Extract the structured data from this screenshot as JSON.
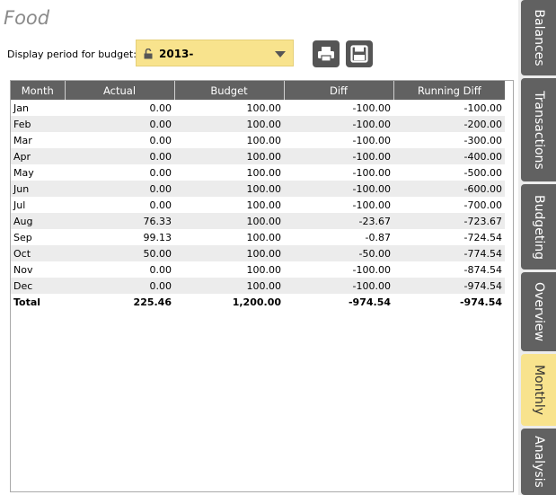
{
  "title": "Food",
  "period": {
    "label": "Display period for budget:",
    "value": "2013-"
  },
  "toolbar": {
    "print_icon": "printer-icon",
    "save_icon": "floppy-disk-icon"
  },
  "table": {
    "headers": [
      "Month",
      "Actual",
      "Budget",
      "Diff",
      "Running Diff"
    ],
    "rows": [
      [
        "Jan",
        "0.00",
        "100.00",
        "-100.00",
        "-100.00"
      ],
      [
        "Feb",
        "0.00",
        "100.00",
        "-100.00",
        "-200.00"
      ],
      [
        "Mar",
        "0.00",
        "100.00",
        "-100.00",
        "-300.00"
      ],
      [
        "Apr",
        "0.00",
        "100.00",
        "-100.00",
        "-400.00"
      ],
      [
        "May",
        "0.00",
        "100.00",
        "-100.00",
        "-500.00"
      ],
      [
        "Jun",
        "0.00",
        "100.00",
        "-100.00",
        "-600.00"
      ],
      [
        "Jul",
        "0.00",
        "100.00",
        "-100.00",
        "-700.00"
      ],
      [
        "Aug",
        "76.33",
        "100.00",
        "-23.67",
        "-723.67"
      ],
      [
        "Sep",
        "99.13",
        "100.00",
        "-0.87",
        "-724.54"
      ],
      [
        "Oct",
        "50.00",
        "100.00",
        "-50.00",
        "-774.54"
      ],
      [
        "Nov",
        "0.00",
        "100.00",
        "-100.00",
        "-874.54"
      ],
      [
        "Dec",
        "0.00",
        "100.00",
        "-100.00",
        "-974.54"
      ]
    ],
    "total": [
      "Total",
      "225.46",
      "1,200.00",
      "-974.54",
      "-974.54"
    ]
  },
  "tabs": [
    {
      "label": "Balances",
      "active": false
    },
    {
      "label": "Transactions",
      "active": false
    },
    {
      "label": "Budgeting",
      "active": false
    },
    {
      "label": "Overview",
      "active": false
    },
    {
      "label": "Monthly",
      "active": true
    },
    {
      "label": "Analysis",
      "active": false
    }
  ],
  "colors": {
    "accent": "#f8e38d",
    "header_bg": "#616161",
    "stripe": "#ececec"
  }
}
